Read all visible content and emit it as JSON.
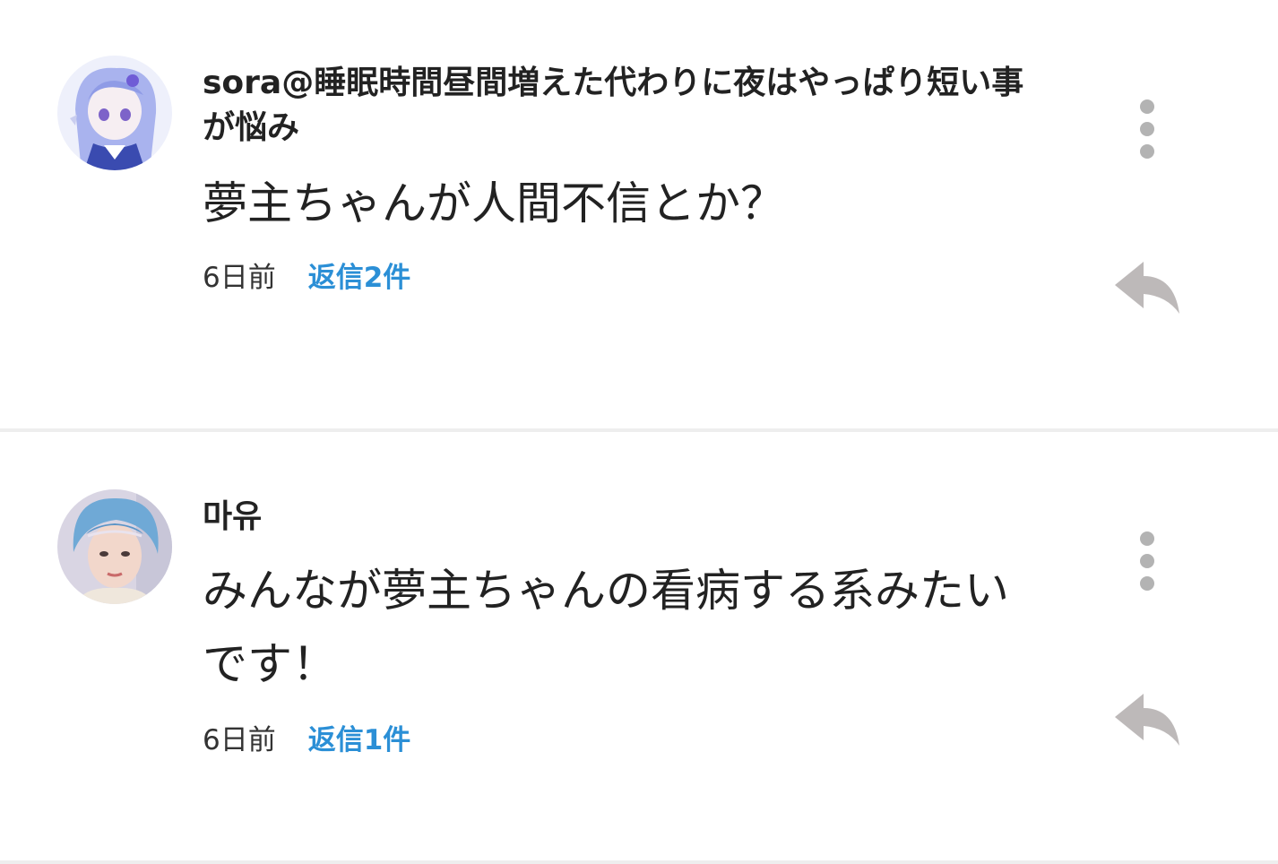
{
  "comments": [
    {
      "username": "sora@睡眠時間昼間増えた代わりに夜はやっぱり短い事が悩み",
      "text": "夢主ちゃんが人間不信とか？",
      "timestamp": "6日前",
      "reply_count": "返信2件",
      "avatar_icon": "anime-character-avatar",
      "more_icon": "vertical-dots-icon",
      "reply_icon": "reply-arrow-icon"
    },
    {
      "username": "마유",
      "text": "みんなが夢主ちゃんの看病する系みたいです！",
      "timestamp": "6日前",
      "reply_count": "返信1件",
      "avatar_icon": "person-photo-avatar",
      "more_icon": "vertical-dots-icon",
      "reply_icon": "reply-arrow-icon"
    }
  ],
  "colors": {
    "accent": "#2b8fd6",
    "text": "#222222",
    "icon": "#b3b3b3",
    "divider": "#eeeeee"
  }
}
